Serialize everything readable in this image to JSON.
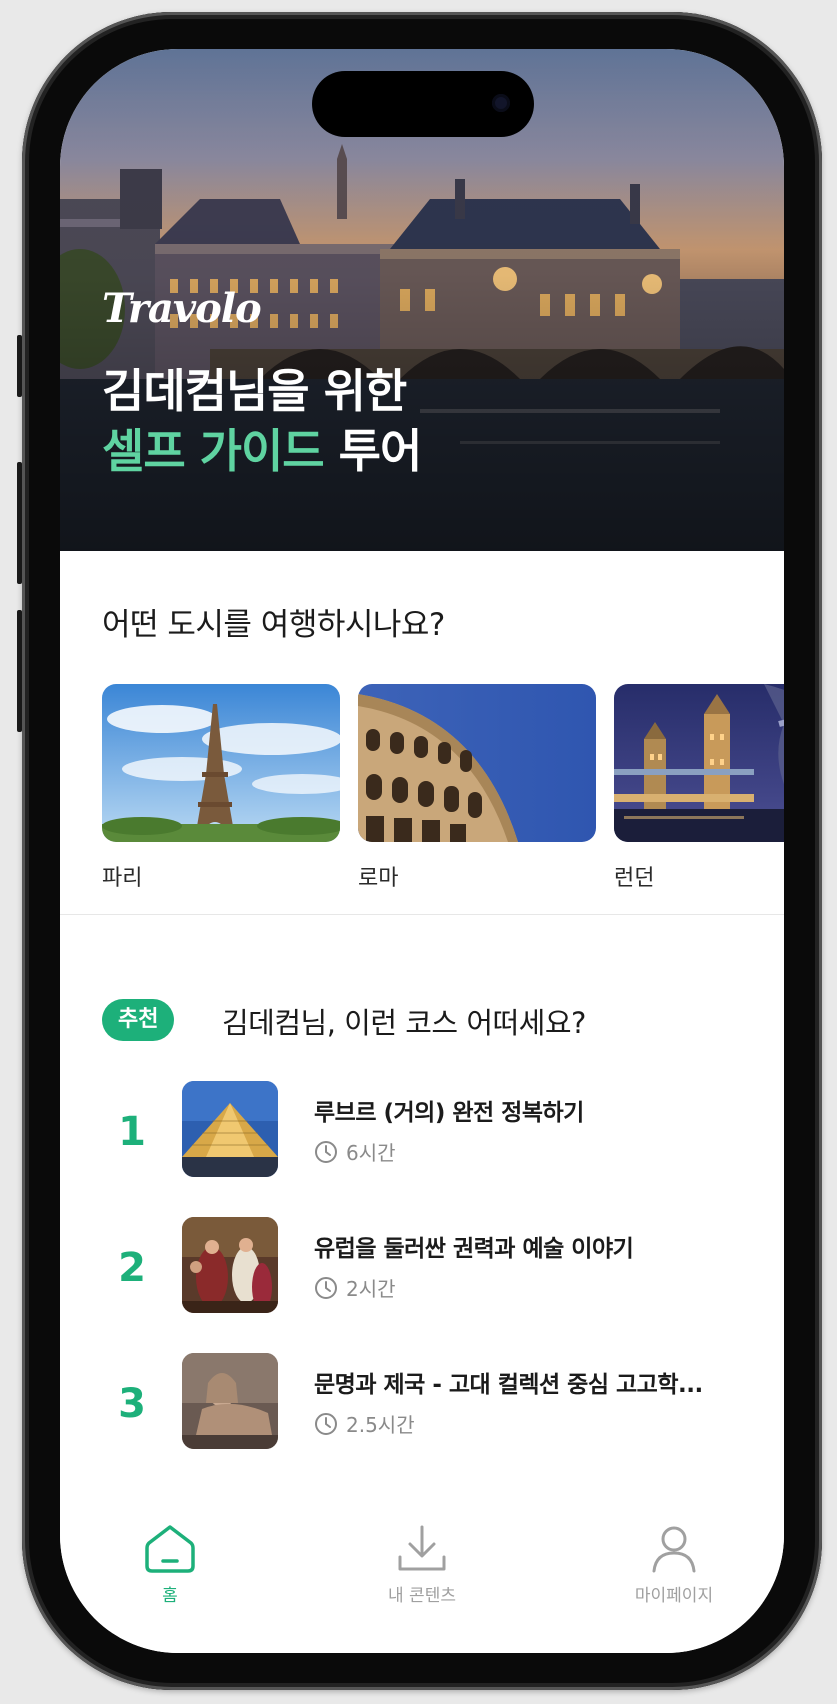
{
  "hero": {
    "brand": "Travolo",
    "headline_line1": "김데컴님을 위한",
    "headline_line2_accent": "셀프 가이드",
    "headline_line2_rest": " 투어"
  },
  "cities": {
    "title": "어떤 도시를 여행하시나요?",
    "items": [
      {
        "name": "파리",
        "image": "eiffel-tower"
      },
      {
        "name": "로마",
        "image": "colosseum"
      },
      {
        "name": "런던",
        "image": "tower-bridge"
      }
    ]
  },
  "recommend": {
    "badge": "추천",
    "title": "김데컴님, 이런 코스 어떠세요?",
    "courses": [
      {
        "rank": "1",
        "title": "루브르 (거의) 완전 정복하기",
        "duration": "6시간",
        "image": "louvre-pyramid"
      },
      {
        "rank": "2",
        "title": "유럽을 둘러싼 권력과 예술 이야기",
        "duration": "2시간",
        "image": "coronation-painting"
      },
      {
        "rank": "3",
        "title": "문명과 제국 - 고대 컬렉션 중심 고고학...",
        "duration": "2.5시간",
        "image": "sphinx-sculpture"
      }
    ]
  },
  "tabbar": {
    "items": [
      {
        "label": "홈",
        "icon": "home-icon",
        "active": true
      },
      {
        "label": "내 콘텐츠",
        "icon": "download-icon",
        "active": false
      },
      {
        "label": "마이페이지",
        "icon": "person-icon",
        "active": false
      }
    ]
  },
  "colors": {
    "accent": "#1db07a",
    "hero_accent": "#5fd3a1",
    "inactive_tab": "#a0a0a0"
  }
}
